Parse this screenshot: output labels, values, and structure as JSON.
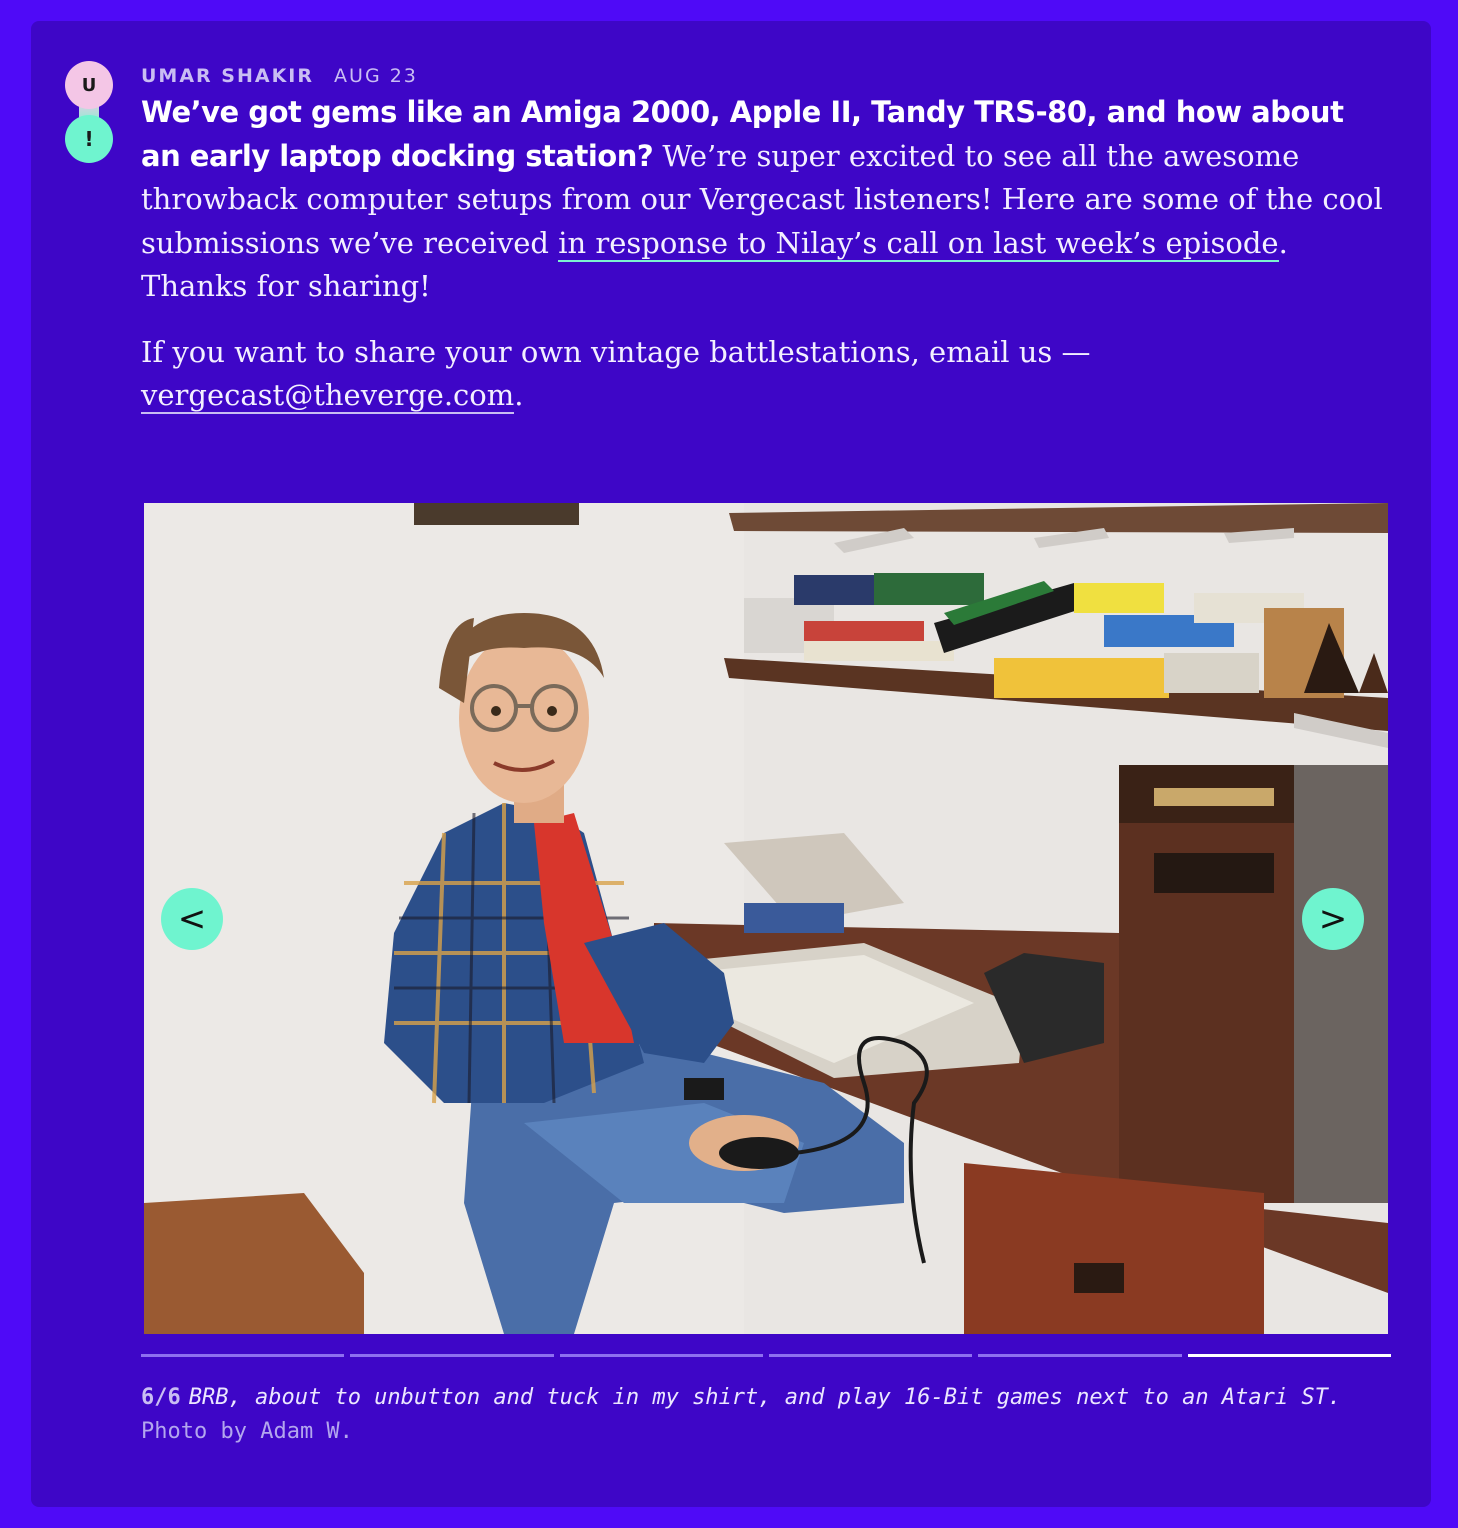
{
  "post": {
    "avatar_letter": "U",
    "avatar_badge": "!",
    "author": "UMAR SHAKIR",
    "date": "AUG 23",
    "headline": "We’ve got gems like an Amiga 2000, Apple II, Tandy TRS-80, and how about an early laptop docking station?",
    "body_part1": " We’re super excited to see all the awesome throwback computer setups from our Vergecast listeners! Here are some of the cool submissions we’ve received ",
    "body_link": "in response to Nilay’s call on last week’s episode",
    "body_part2": ". Thanks for sharing!",
    "share_text": "If you want to share your own vintage battlestations, email us — ",
    "email_link": "vergecast@theverge.com",
    "share_end": "."
  },
  "gallery": {
    "prev_label": "<",
    "next_label": ">",
    "current": 6,
    "total": 6,
    "counter": "6/6",
    "caption": "BRB, about to unbutton and tuck in my shirt, and play 16-Bit games next to an Atari ST.",
    "credit": " Photo by Adam W.",
    "image_alt": "Boy in plaid shirt sitting at a desk with an Atari ST computer, shelves of games above"
  },
  "colors": {
    "page_bg": "#4f0af7",
    "card_bg": "#3e06c7",
    "accent": "#6ff4cf",
    "avatar_pink": "#f4c6e6"
  }
}
